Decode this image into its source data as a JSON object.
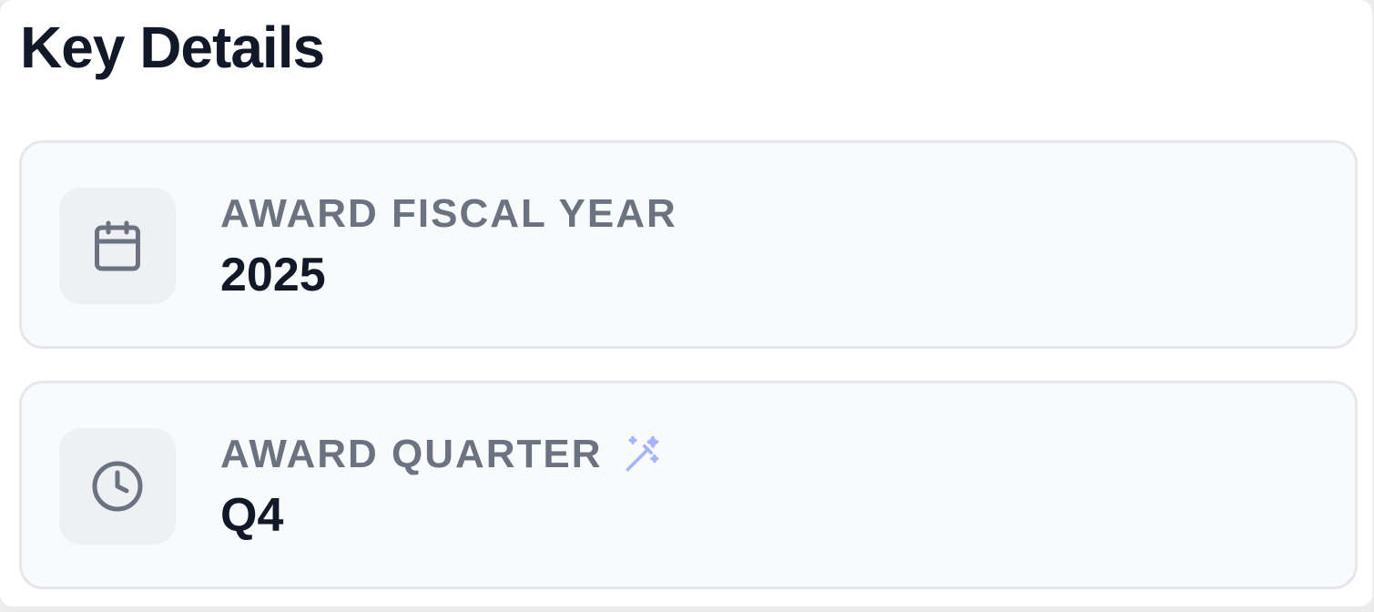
{
  "section": {
    "title": "Key Details"
  },
  "details": [
    {
      "label": "AWARD FISCAL YEAR",
      "value": "2025",
      "icon": "calendar-icon"
    },
    {
      "label": "AWARD QUARTER",
      "value": "Q4",
      "icon": "clock-icon",
      "badge_icon": "magic-wand-icon"
    }
  ],
  "colors": {
    "title": "#111827",
    "label": "#6b7280",
    "value": "#111827",
    "icon": "#6b7280",
    "wand_accent": "#a5b4fc",
    "card_bg": "#f9fafb",
    "card_border": "#e5e7eb",
    "icon_bg": "#eef0f3"
  }
}
